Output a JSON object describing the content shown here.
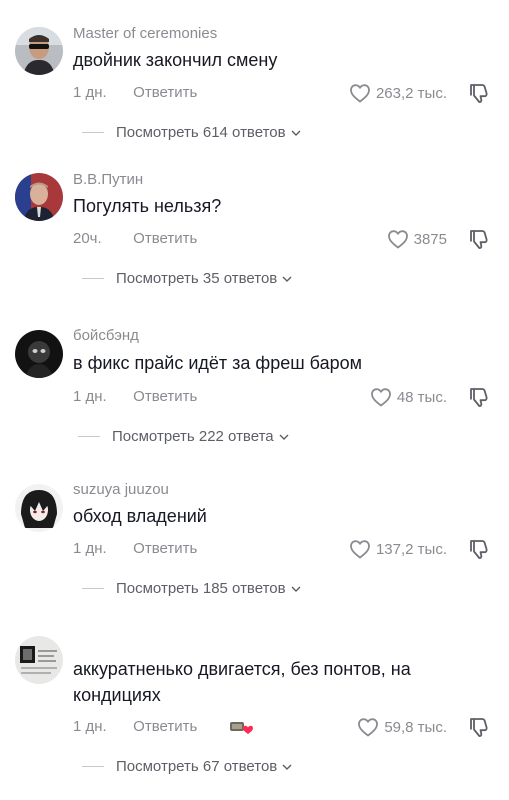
{
  "comments": [
    {
      "username": "Master of ceremonies",
      "text": "двойник закончил смену",
      "time": "1 дн.",
      "reply": "Ответить",
      "likes": "263,2 тыс.",
      "view_replies": "Посмотреть 614 ответов"
    },
    {
      "username": "В.В.Путин",
      "text": "Погулять нельзя?",
      "time": "20ч.",
      "reply": "Ответить",
      "likes": "3875",
      "view_replies": "Посмотреть 35 ответов"
    },
    {
      "username": "бойсбэнд",
      "text": "в фикс прайс идёт за фреш баром",
      "time": "1 дн.",
      "reply": "Ответить",
      "likes": "48 тыс.",
      "view_replies": "Посмотреть 222 ответа"
    },
    {
      "username": "suzuya juuzou",
      "text": "обход владений",
      "time": "1 дн.",
      "reply": "Ответить",
      "likes": "137,2 тыс.",
      "view_replies": "Посмотреть 185 ответов"
    },
    {
      "username": "",
      "text": "аккуратненько двигается, без понтов, на кондициях",
      "time": "1 дн.",
      "reply": "Ответить",
      "likes": "59,8 тыс.",
      "view_replies": "Посмотреть 67 ответов"
    }
  ],
  "icons": {
    "like": "heart-outline-icon",
    "dislike": "thumbs-down-icon",
    "expand": "chevron-down-icon",
    "creator_liked": "creator-liked-badge-icon"
  },
  "colors": {
    "primary_text": "#161823",
    "secondary_text": "#8a8b91",
    "heart_badge": "#fe2c55"
  }
}
